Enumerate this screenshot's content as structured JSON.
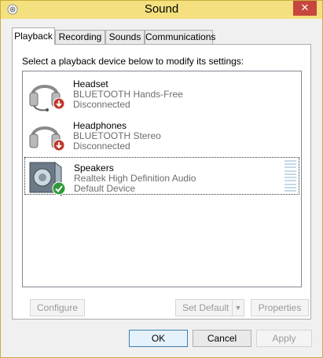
{
  "window": {
    "title": "Sound",
    "close_glyph": "✕"
  },
  "tabs": [
    {
      "label": "Playback",
      "active": true
    },
    {
      "label": "Recording",
      "active": false
    },
    {
      "label": "Sounds",
      "active": false
    },
    {
      "label": "Communications",
      "active": false
    }
  ],
  "playback": {
    "instruction": "Select a playback device below to modify its settings:",
    "devices": [
      {
        "name": "Headset",
        "driver": "BLUETOOTH Hands-Free",
        "status": "Disconnected",
        "icon": "headset-icon",
        "badge": "disconnected-badge-icon"
      },
      {
        "name": "Headphones",
        "driver": "BLUETOOTH Stereo",
        "status": "Disconnected",
        "icon": "headphones-icon",
        "badge": "disconnected-badge-icon"
      },
      {
        "name": "Speakers",
        "driver": "Realtek High Definition Audio",
        "status": "Default Device",
        "icon": "speakers-icon",
        "badge": "default-device-check-icon",
        "selected": true
      }
    ],
    "configure_label": "Configure",
    "set_default_label": "Set Default",
    "properties_label": "Properties"
  },
  "footer": {
    "ok_label": "OK",
    "cancel_label": "Cancel",
    "apply_label": "Apply"
  },
  "colors": {
    "title_bar": "#f4e07e",
    "close_button": "#c7463d",
    "disconnected_badge": "#c0392b",
    "default_check": "#2f9a3a",
    "level_meter": "#c4d9e6"
  }
}
